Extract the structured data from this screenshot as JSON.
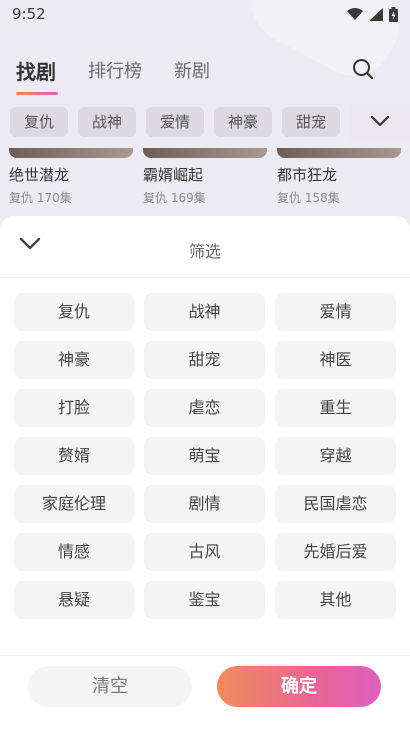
{
  "status_bar": {
    "time": "9:52",
    "icons": [
      "wifi-icon",
      "signal-icon",
      "battery-icon"
    ]
  },
  "top_nav": {
    "tabs": [
      {
        "label": "找剧",
        "active": true
      },
      {
        "label": "排行榜",
        "active": false
      },
      {
        "label": "新剧",
        "active": false
      }
    ],
    "search_icon": "search-icon"
  },
  "chips": [
    "复仇",
    "战神",
    "爱情",
    "神豪",
    "甜宠"
  ],
  "cards": [
    {
      "title": "绝世潜龙",
      "meta": "复仇 170集"
    },
    {
      "title": "霸婿崛起",
      "meta": "复仇 169集"
    },
    {
      "title": "都市狂龙",
      "meta": "复仇 158集"
    }
  ],
  "sheet": {
    "title": "筛选",
    "tags": [
      "复仇",
      "战神",
      "爱情",
      "神豪",
      "甜宠",
      "神医",
      "打脸",
      "虐恋",
      "重生",
      "赘婿",
      "萌宝",
      "穿越",
      "家庭伦理",
      "剧情",
      "民国虐恋",
      "情感",
      "古风",
      "先婚后爱",
      "悬疑",
      "鉴宝",
      "其他"
    ],
    "clear_label": "清空",
    "confirm_label": "确定"
  },
  "colors": {
    "accent_start": "#f28b5a",
    "accent_end": "#e05ec0"
  }
}
